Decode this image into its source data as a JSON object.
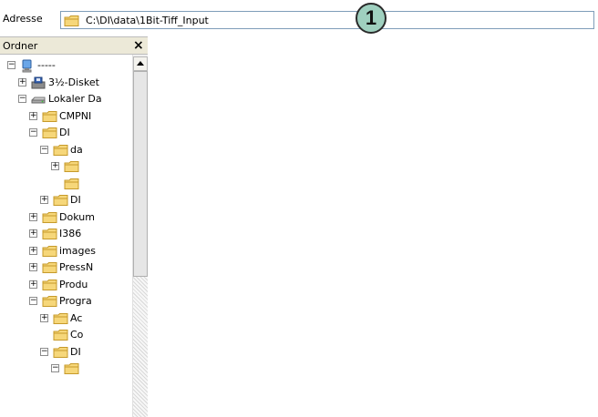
{
  "address": {
    "label": "Adresse",
    "path": "C:\\DI\\data\\1Bit-Tiff_Input",
    "callout": "1"
  },
  "folders_pane": {
    "title": "Ordner",
    "close_glyph": "×"
  },
  "tree": [
    {
      "label": "-----",
      "icon": "computer-icon",
      "expander": "⊟"
    },
    {
      "label": "3½-Disket",
      "icon": "floppy-icon",
      "expander": "⊞"
    },
    {
      "label": "Lokaler Da",
      "icon": "drive-icon",
      "expander": "⊟"
    },
    {
      "label": "CMPNI",
      "icon": "folder-icon",
      "expander": "⊞"
    },
    {
      "label": "DI",
      "icon": "folder-icon",
      "expander": "⊟"
    },
    {
      "label": "da",
      "icon": "folder-icon",
      "expander": "⊟"
    },
    {
      "label": "",
      "icon": "folder-icon",
      "expander": "⊞"
    },
    {
      "label": "",
      "icon": "folder-icon",
      "expander": ""
    },
    {
      "label": "DI",
      "icon": "folder-icon",
      "expander": "⊞"
    },
    {
      "label": "Dokum",
      "icon": "folder-icon",
      "expander": "⊞"
    },
    {
      "label": "I386",
      "icon": "folder-icon",
      "expander": "⊞"
    },
    {
      "label": "images",
      "icon": "folder-icon",
      "expander": "⊞"
    },
    {
      "label": "PressN",
      "icon": "folder-icon",
      "expander": "⊞"
    },
    {
      "label": "Produ",
      "icon": "folder-icon",
      "expander": "⊞"
    },
    {
      "label": "Progra",
      "icon": "folder-icon",
      "expander": "⊟"
    },
    {
      "label": "Ac",
      "icon": "folder-icon",
      "expander": "⊞"
    },
    {
      "label": "Co",
      "icon": "folder-icon",
      "expander": ""
    },
    {
      "label": "DI",
      "icon": "folder-icon",
      "expander": "⊟"
    },
    {
      "label": "",
      "icon": "folder-icon",
      "expander": "⊟"
    }
  ],
  "colors": {
    "folder_fill": "#f6d77a",
    "folder_edge": "#c69a2a",
    "callout_fill": "#9fd0bf"
  }
}
